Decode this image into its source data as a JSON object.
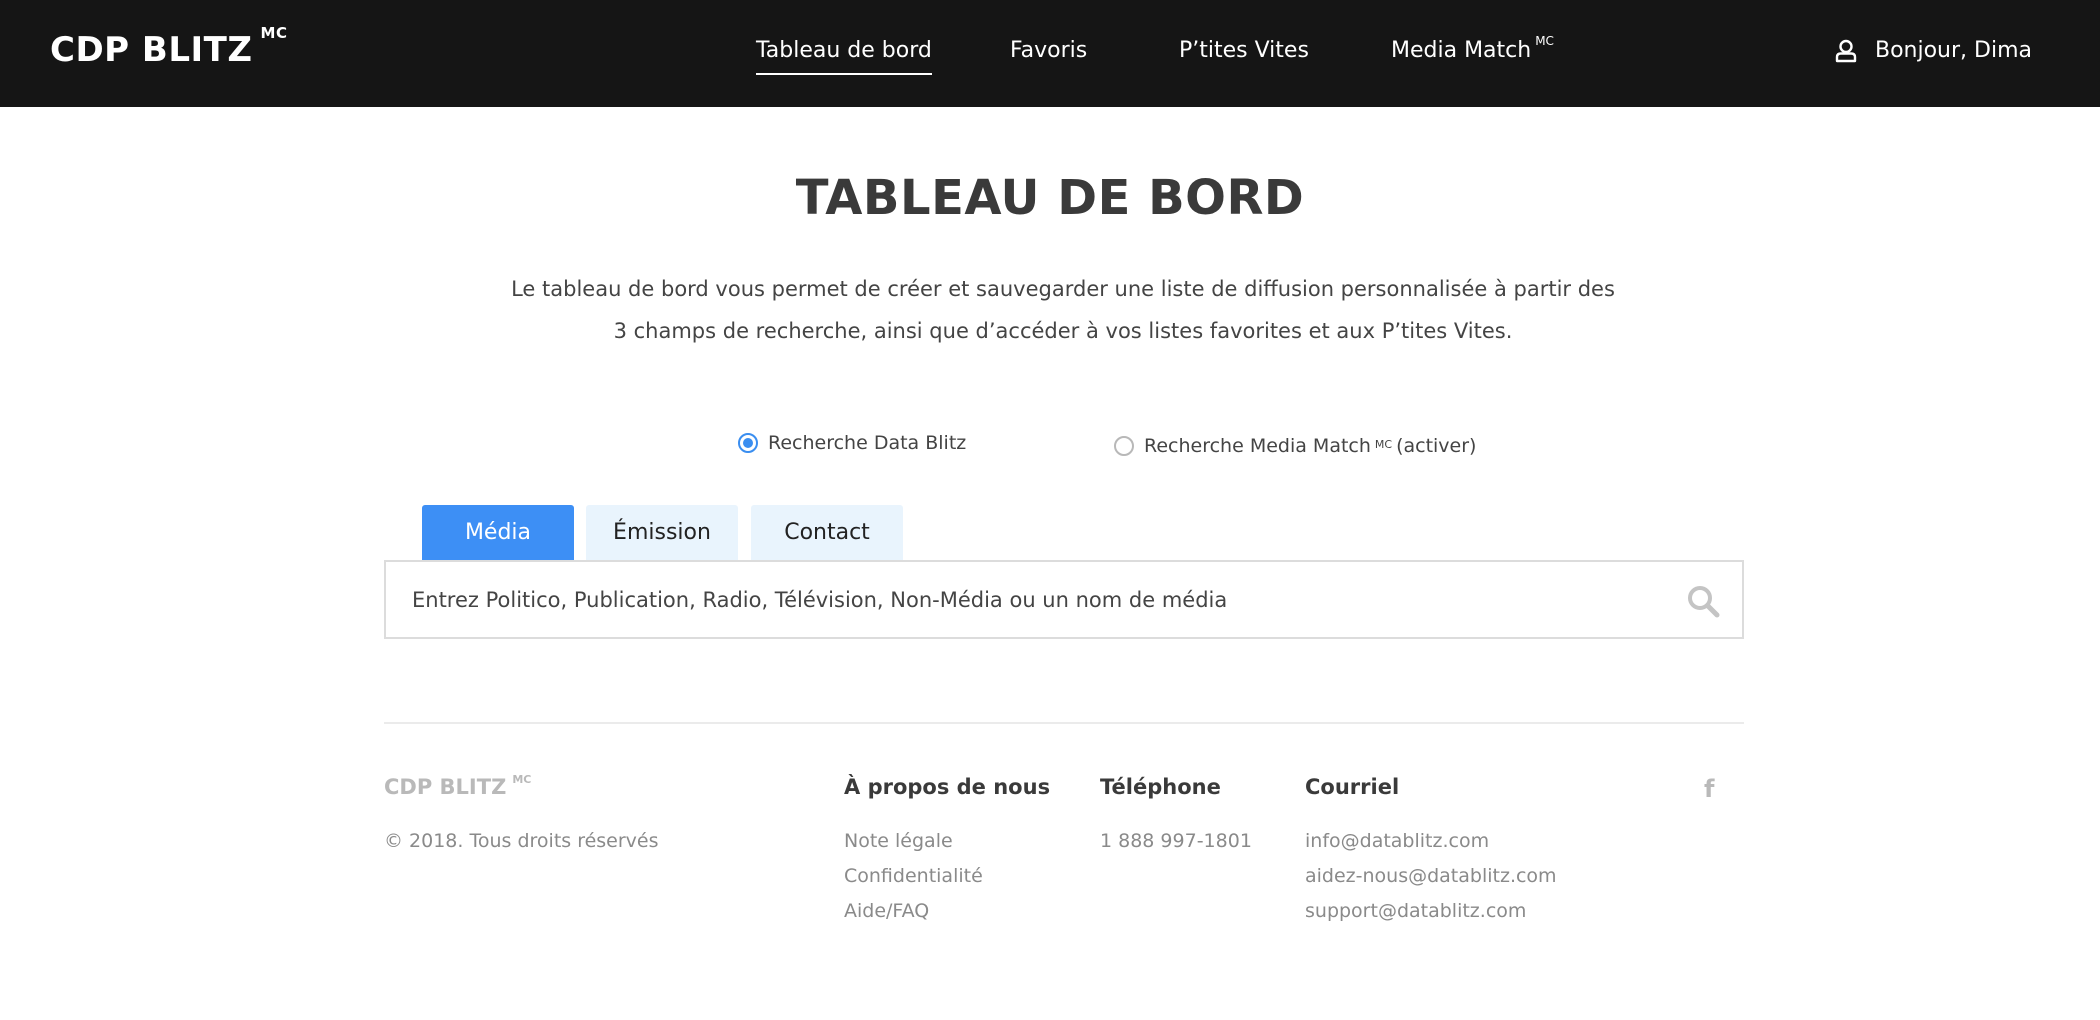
{
  "header": {
    "brand": "CDP BLITZ",
    "brand_mark": "MC",
    "nav": [
      {
        "label": "Tableau de bord",
        "sup": ""
      },
      {
        "label": "Favoris",
        "sup": ""
      },
      {
        "label": "P’tites Vites",
        "sup": ""
      },
      {
        "label": "Media Match",
        "sup": "MC"
      }
    ],
    "user_greeting": "Bonjour, Dima",
    "user_icon": "user-icon"
  },
  "main": {
    "title": "TABLEAU DE BORD",
    "intro_line1": "Le tableau de bord vous permet de créer et sauvegarder une liste de diffusion personnalisée à partir des",
    "intro_line2": "3 champs de recherche, ainsi que d’accéder à vos listes favorites et aux P’tites Vites.",
    "radios": [
      {
        "label": "Recherche Data Blitz",
        "selected": true
      },
      {
        "label": "Recherche Media Match",
        "sup": "MC",
        "suffix": "(activer)",
        "selected": false
      }
    ],
    "tabs": [
      {
        "label": "Média",
        "active": true
      },
      {
        "label": "Émission",
        "active": false
      },
      {
        "label": "Contact",
        "active": false
      }
    ],
    "search_placeholder": "Entrez Politico, Publication, Radio, Télévision, Non-Média ou un nom de média",
    "search_icon": "search-icon"
  },
  "footer": {
    "brand": "CDP BLITZ",
    "brand_mark": "MC",
    "copyright": "© 2018. Tous droits réservés",
    "about": {
      "title": "À propos de nous",
      "links": [
        "Note légale",
        "Confidentialité",
        "Aide/FAQ"
      ]
    },
    "phone": {
      "title": "Téléphone",
      "number": "1 888 997-1801"
    },
    "email": {
      "title": "Courriel",
      "links": [
        "info@datablitz.com",
        "aidez-nous@datablitz.com",
        "support@datablitz.com"
      ]
    },
    "social_icon": "facebook-icon",
    "social_glyph": "f"
  },
  "colors": {
    "header_bg": "#151515",
    "accent": "#3d8ff5",
    "tab_inactive_bg": "#e9f4fd",
    "muted_text": "#8a8a8a"
  }
}
